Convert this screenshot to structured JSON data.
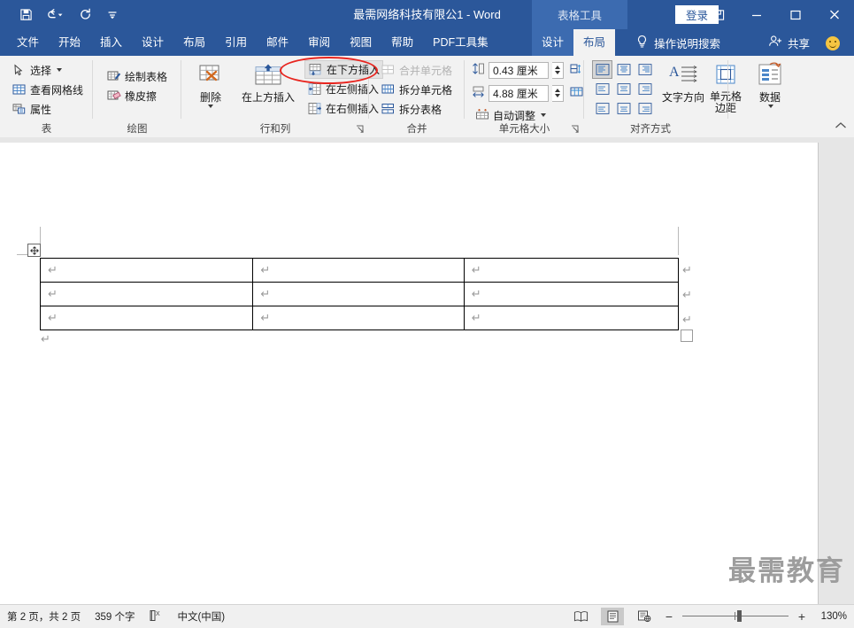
{
  "titlebar": {
    "document_title": "最需网络科技有限公1  -  Word",
    "contextual_tools_label": "表格工具",
    "signin_label": "登录",
    "quick_access": [
      {
        "name": "save-icon",
        "label": "保存"
      },
      {
        "name": "undo-icon",
        "label": "撤消"
      },
      {
        "name": "redo-icon",
        "label": "重复"
      },
      {
        "name": "customize-qat-icon",
        "label": "自定义快速访问工具栏"
      }
    ],
    "window_buttons": [
      {
        "name": "ribbon-display-options-icon",
        "label": "功能区显示选项"
      },
      {
        "name": "minimize-icon",
        "label": "最小化"
      },
      {
        "name": "maximize-icon",
        "label": "最大化"
      },
      {
        "name": "close-icon",
        "label": "关闭"
      }
    ]
  },
  "tabs": {
    "main": [
      "文件",
      "开始",
      "插入",
      "设计",
      "布局",
      "引用",
      "邮件",
      "审阅",
      "视图",
      "帮助",
      "PDF工具集"
    ],
    "contextual": [
      "设计",
      "布局"
    ],
    "active": "布局",
    "tell_me": "操作说明搜索",
    "share": "共享"
  },
  "ribbon": {
    "groups": [
      {
        "name": "表",
        "items": [
          {
            "label": "选择",
            "icon": "select-table-icon",
            "dropdown": true
          },
          {
            "label": "查看网格线",
            "icon": "view-gridlines-icon"
          },
          {
            "label": "属性",
            "icon": "table-properties-icon"
          }
        ]
      },
      {
        "name": "绘图",
        "items": [
          {
            "label": "绘制表格",
            "icon": "draw-table-icon"
          },
          {
            "label": "橡皮擦",
            "icon": "eraser-icon"
          }
        ]
      },
      {
        "name": "行和列",
        "items": [
          {
            "label": "删除",
            "icon": "delete-table-icon",
            "dropdown": true
          },
          {
            "label": "在上方插入",
            "icon": "insert-above-icon"
          },
          {
            "label": "在下方插入",
            "icon": "insert-below-icon",
            "highlighted": true
          },
          {
            "label": "在左侧插入",
            "icon": "insert-left-icon"
          },
          {
            "label": "在右侧插入",
            "icon": "insert-right-icon"
          }
        ],
        "has_launcher": true
      },
      {
        "name": "合并",
        "items": [
          {
            "label": "合并单元格",
            "icon": "merge-cells-icon",
            "disabled": true
          },
          {
            "label": "拆分单元格",
            "icon": "split-cells-icon"
          },
          {
            "label": "拆分表格",
            "icon": "split-table-icon"
          }
        ]
      },
      {
        "name": "单元格大小",
        "row_height": "0.43 厘米",
        "column_width": "4.88 厘米",
        "autofit_label": "自动调整",
        "distribute_rows_icon": "distribute-rows-icon",
        "distribute_cols_icon": "distribute-columns-icon",
        "has_launcher": true
      },
      {
        "name": "对齐方式",
        "items": [
          {
            "label": "文字方向",
            "icon": "text-direction-icon"
          },
          {
            "label": "单元格边距",
            "icon": "cell-margins-icon"
          }
        ],
        "alignment_options": [
          "靠上两端对齐",
          "靠上居中对齐",
          "靠上右对齐",
          "中部两端对齐",
          "水平居中",
          "中部右对齐",
          "靠下两端对齐",
          "靠下居中对齐",
          "靠下右对齐"
        ],
        "alignment_selected_index": 0
      },
      {
        "name": "数据",
        "items": [
          {
            "label": "数据",
            "icon": "data-icon",
            "dropdown": true
          }
        ]
      }
    ],
    "collapse_label": "折叠功能区"
  },
  "document": {
    "table": {
      "rows": 3,
      "columns": 3,
      "cells": [
        [
          "↵",
          "↵",
          "↵"
        ],
        [
          "↵",
          "↵",
          "↵"
        ],
        [
          "↵",
          "↵",
          "↵"
        ]
      ],
      "end_of_row_marks": [
        "↵",
        "↵",
        "↵"
      ],
      "end_paragraph_mark": "↵"
    },
    "watermark": "最需教育"
  },
  "statusbar": {
    "page_info": "第 2 页，共 2 页",
    "word_count": "359 个字",
    "proofing_icon": "proofing-errors-icon",
    "language": "中文(中国)",
    "views": [
      {
        "name": "read-mode-icon",
        "label": "阅读视图",
        "active": false
      },
      {
        "name": "print-layout-icon",
        "label": "页面视图",
        "active": true
      },
      {
        "name": "web-layout-icon",
        "label": "Web 版式视图",
        "active": false
      }
    ],
    "zoom_out": "−",
    "zoom_in": "+",
    "zoom_level": "130%"
  },
  "annotation": {
    "shape": "red-ellipse",
    "color": "#e8251f",
    "targets": "在下方插入"
  },
  "colors": {
    "word_blue": "#2b579a",
    "contextual_blue": "#3c6bb0",
    "ribbon_bg": "#f2f2f2",
    "page_bg": "#e6e6e6",
    "annotation_red": "#e8251f"
  }
}
